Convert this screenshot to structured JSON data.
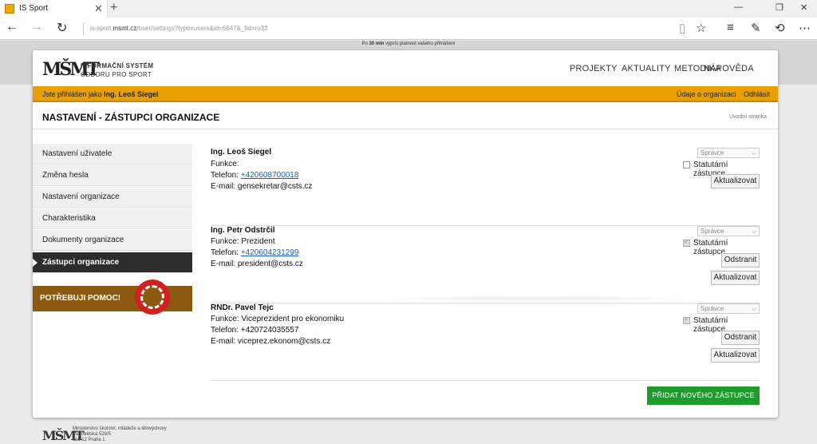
{
  "browser": {
    "tab_title": "IS Sport",
    "url_prefix": "is-sport.",
    "url_host": "msmt.cz",
    "url_path": "/user/settings?type=users&id=6647&_fid=ro32"
  },
  "session": {
    "timeout_prefix": "Po ",
    "timeout_minutes": "30 min",
    "timeout_suffix": " vyprší platnost vašeho přihlášení"
  },
  "header": {
    "logo_text": "MŠMT",
    "brand_line1": "INFORMAČNÍ SYSTÉM",
    "brand_line2": "ODBORU PRO SPORT",
    "menu": [
      "PROJEKTY",
      "AKTUALITY",
      "METODIKA",
      "NÁPOVĚDA"
    ]
  },
  "userbar": {
    "logged_in_prefix": "Jste přihlášen jako ",
    "user_name": "Ing. Leoš Siegel",
    "org_info_link": "Údaje o organizaci",
    "logout_link": "Odhlásit"
  },
  "page": {
    "title": "NASTAVENÍ - ZÁSTUPCI ORGANIZACE",
    "breadcrumb": "Úvodní stránka"
  },
  "sidebar": {
    "items": [
      {
        "label": "Nastavení uživatele"
      },
      {
        "label": "Změna hesla"
      },
      {
        "label": "Nastavení organizace"
      },
      {
        "label": "Charakteristika"
      },
      {
        "label": "Dokumenty organizace"
      },
      {
        "label": "Zástupci organizace"
      }
    ],
    "help_label": "POTŘEBUJI POMOC!"
  },
  "representatives": [
    {
      "name": "Ing. Leoš Siegel",
      "function_label": "Funkce:",
      "phone_label": "Telefon: ",
      "phone": "+420608700018",
      "email_label": "E-mail: ",
      "email": "gensekretar@csts.cz",
      "role": "Správce",
      "statutory_label": "Statutární zástupce",
      "statutory": false,
      "remove_label": "",
      "update_label": "Aktualizovat"
    },
    {
      "name": "Ing. Petr Odstrčil",
      "function_label": "Funkce: Prezident",
      "phone_label": "Telefon: ",
      "phone": "+420604231299",
      "email_label": "E-mail: ",
      "email": "president@csts.cz",
      "role": "Správce",
      "statutory_label": "Statutární zástupce",
      "statutory": true,
      "remove_label": "Odstranit",
      "update_label": "Aktualizovat"
    },
    {
      "name": "RNDr. Pavel Tejc",
      "function_label": "Funkce: Viceprezident pro ekonomiku",
      "phone_label": "Telefon: +420724035557",
      "phone": "",
      "email_label": "E-mail: ",
      "email": "viceprez.ekonom@csts.cz",
      "role": "Správce",
      "statutory_label": "Statutární zástupce",
      "statutory": true,
      "remove_label": "Odstranit",
      "update_label": "Aktualizovat"
    }
  ],
  "add_button_label": "PŘIDAT NOVÉHO ZÁSTUPCE",
  "footer": {
    "logo_text": "MŠMT",
    "line1": "Ministerstvo školství, mládeže a tělovýchovy",
    "line2": "Karmelitská 529/5",
    "line3": "118 12 Praha 1"
  }
}
